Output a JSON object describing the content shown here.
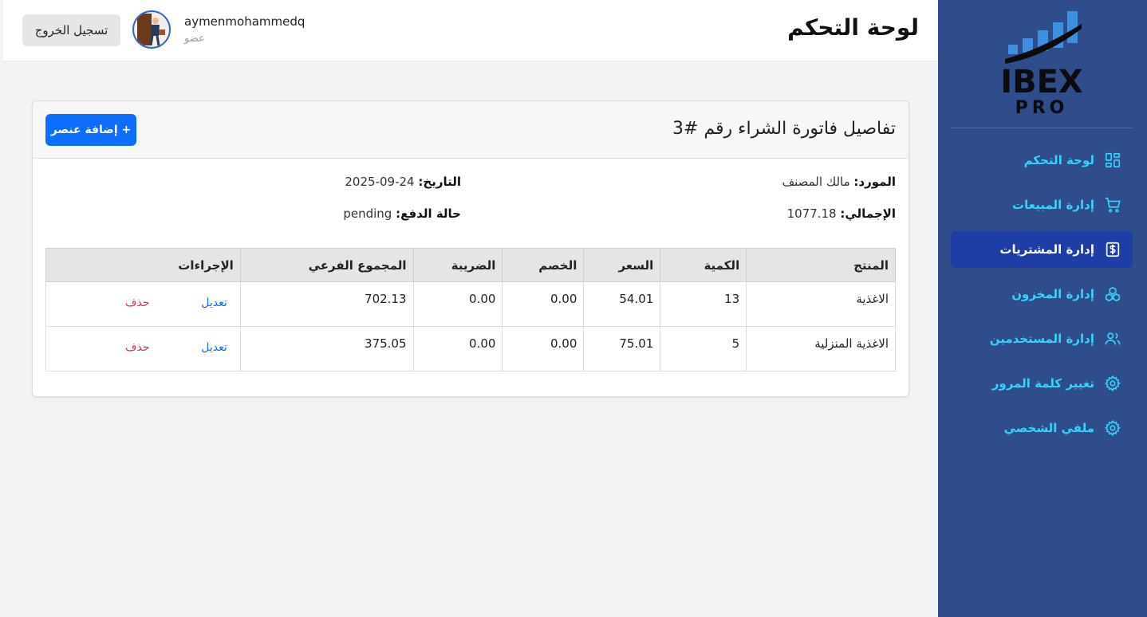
{
  "brand": {
    "logo_text": "IBEX",
    "logo_sub": "PRO",
    "bar_color": "#3f8fe0"
  },
  "sidebar": {
    "items": [
      {
        "label": "لوحة التحكم",
        "icon": "dashboard-icon"
      },
      {
        "label": "إدارة المبيعات",
        "icon": "cart-icon"
      },
      {
        "label": "إدارة المشتريات",
        "icon": "dollar-icon",
        "active": true
      },
      {
        "label": "إدارة المخزون",
        "icon": "boxes-icon"
      },
      {
        "label": "إدارة المستخدمين",
        "icon": "users-icon"
      },
      {
        "label": "تغيير كلمة المرور",
        "icon": "gear-icon"
      },
      {
        "label": "ملفي الشخصي",
        "icon": "gear-icon"
      }
    ]
  },
  "header": {
    "title": "لوحة التحكم",
    "user_name": "aymenmohammedq",
    "user_role": "عضو",
    "logout_label": "تسجيل الخروج"
  },
  "invoice": {
    "title": "تفاصيل فاتورة الشراء رقم #3",
    "add_label": "+ إضافة عنصر",
    "supplier_label": "المورد:",
    "supplier_value": "مالك المصنف",
    "date_label": "التاريخ:",
    "date_value": "24-09-2025",
    "total_label": "الإجمالي:",
    "total_value": "1077.18",
    "payment_label": "حالة الدفع:",
    "payment_value": "pending"
  },
  "table": {
    "columns": [
      "المنتج",
      "الكمية",
      "السعر",
      "الخصم",
      "الضريبة",
      "المجموع الفرعي",
      "الإجراءات"
    ],
    "rows": [
      {
        "product": "الاغذية",
        "qty": "13",
        "price": "54.01",
        "discount": "0.00",
        "tax": "0.00",
        "subtotal": "702.13"
      },
      {
        "product": "الاغذية المنزلية",
        "qty": "5",
        "price": "75.01",
        "discount": "0.00",
        "tax": "0.00",
        "subtotal": "375.05"
      }
    ],
    "edit_label": "تعديل",
    "delete_label": "حذف"
  },
  "colors": {
    "sidebar_bg": "#2f4d8a",
    "nav_text": "#35d2ff",
    "nav_active": "#1e3da7",
    "primary": "#0d6efd",
    "danger": "#dc3545"
  }
}
